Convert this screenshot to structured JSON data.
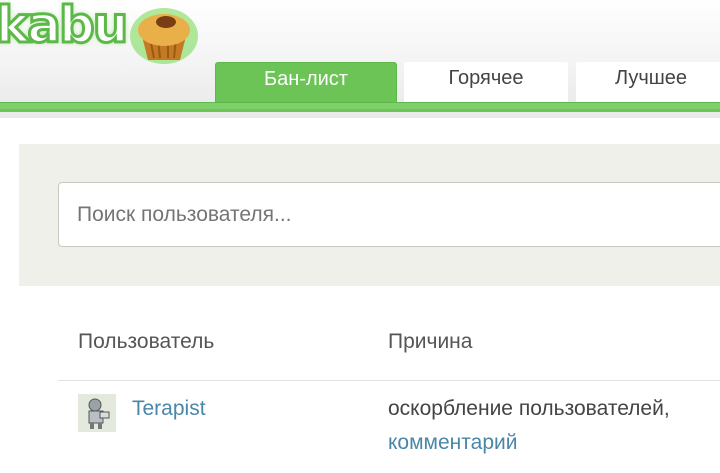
{
  "header": {
    "logo_text": "kabu",
    "tabs": [
      {
        "label": "Бан-лист",
        "active": true
      },
      {
        "label": "Горячее",
        "active": false
      },
      {
        "label": "Лучшее",
        "active": false
      }
    ],
    "accent": "#6cc456"
  },
  "search": {
    "placeholder": "Поиск пользователя..."
  },
  "table": {
    "columns": [
      "Пользователь",
      "Причина"
    ],
    "rows": [
      {
        "user": "Terapist",
        "reason": "оскорбление пользователей,",
        "reason_link": "комментарий"
      }
    ]
  },
  "colors": {
    "link": "#4a86a8",
    "panel": "#eef0e9"
  }
}
